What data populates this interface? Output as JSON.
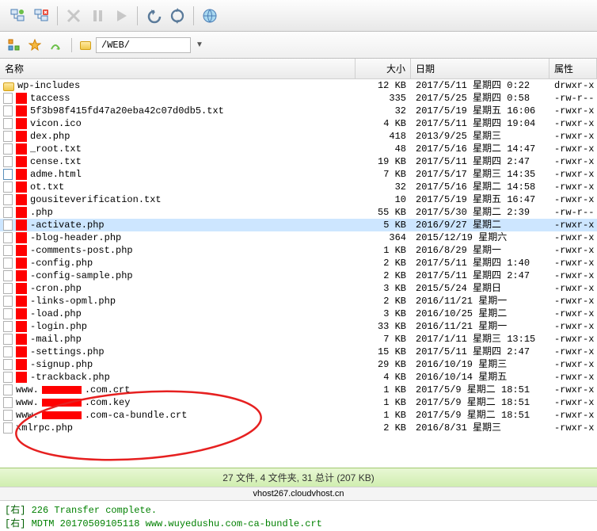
{
  "path": "/WEB/",
  "columns": {
    "name": "名称",
    "size": "大小",
    "date": "日期",
    "attr": "属性"
  },
  "rows": [
    {
      "icon": "folder",
      "name": "wp-includes",
      "size": "12 KB",
      "date": "2017/5/11 星期四 0:22",
      "attr": "drwxr-x"
    },
    {
      "icon": "file",
      "redact": true,
      "name": "taccess",
      "size": "335",
      "date": "2017/5/25 星期四 0:58",
      "attr": "-rw-r--"
    },
    {
      "icon": "file",
      "redact": true,
      "name": "5f3b98f415fd47a20eba42c07d0db5.txt",
      "size": "32",
      "date": "2017/5/19 星期五 16:06",
      "attr": "-rwxr-x"
    },
    {
      "icon": "file",
      "redact": true,
      "name": "vicon.ico",
      "size": "4 KB",
      "date": "2017/5/11 星期四 19:04",
      "attr": "-rwxr-x"
    },
    {
      "icon": "file",
      "redact": true,
      "name": "dex.php",
      "size": "418",
      "date": "2013/9/25 星期三",
      "attr": "-rwxr-x"
    },
    {
      "icon": "file",
      "redact": true,
      "name": "_root.txt",
      "size": "48",
      "date": "2017/5/16 星期二 14:47",
      "attr": "-rwxr-x"
    },
    {
      "icon": "file",
      "redact": true,
      "name": "cense.txt",
      "size": "19 KB",
      "date": "2017/5/11 星期四 2:47",
      "attr": "-rwxr-x"
    },
    {
      "icon": "html",
      "redact": true,
      "name": "adme.html",
      "size": "7 KB",
      "date": "2017/5/17 星期三 14:35",
      "attr": "-rwxr-x"
    },
    {
      "icon": "file",
      "redact": true,
      "name": "ot.txt",
      "size": "32",
      "date": "2017/5/16 星期二 14:58",
      "attr": "-rwxr-x"
    },
    {
      "icon": "file",
      "redact": true,
      "name": "gousiteverification.txt",
      "size": "10",
      "date": "2017/5/19 星期五 16:47",
      "attr": "-rwxr-x"
    },
    {
      "icon": "file",
      "redact": true,
      "name": ".php",
      "size": "55 KB",
      "date": "2017/5/30 星期二 2:39",
      "attr": "-rw-r--"
    },
    {
      "icon": "file",
      "redact": true,
      "name": "-activate.php",
      "sel": true,
      "size": "5 KB",
      "date": "2016/9/27 星期二",
      "attr": "-rwxr-x"
    },
    {
      "icon": "file",
      "redact": true,
      "name": "-blog-header.php",
      "size": "364",
      "date": "2015/12/19 星期六",
      "attr": "-rwxr-x"
    },
    {
      "icon": "file",
      "redact": true,
      "name": "-comments-post.php",
      "size": "1 KB",
      "date": "2016/8/29 星期一",
      "attr": "-rwxr-x"
    },
    {
      "icon": "file",
      "redact": true,
      "name": "-config.php",
      "size": "2 KB",
      "date": "2017/5/11 星期四 1:40",
      "attr": "-rwxr-x"
    },
    {
      "icon": "file",
      "redact": true,
      "name": "-config-sample.php",
      "size": "2 KB",
      "date": "2017/5/11 星期四 2:47",
      "attr": "-rwxr-x"
    },
    {
      "icon": "file",
      "redact": true,
      "name": "-cron.php",
      "size": "3 KB",
      "date": "2015/5/24 星期日",
      "attr": "-rwxr-x"
    },
    {
      "icon": "file",
      "redact": true,
      "name": "-links-opml.php",
      "size": "2 KB",
      "date": "2016/11/21 星期一",
      "attr": "-rwxr-x"
    },
    {
      "icon": "file",
      "redact": true,
      "name": "-load.php",
      "size": "3 KB",
      "date": "2016/10/25 星期二",
      "attr": "-rwxr-x"
    },
    {
      "icon": "file",
      "redact": true,
      "name": "-login.php",
      "size": "33 KB",
      "date": "2016/11/21 星期一",
      "attr": "-rwxr-x"
    },
    {
      "icon": "file",
      "redact": true,
      "name": "-mail.php",
      "size": "7 KB",
      "date": "2017/1/11 星期三 13:15",
      "attr": "-rwxr-x"
    },
    {
      "icon": "file",
      "redact": true,
      "name": "-settings.php",
      "size": "15 KB",
      "date": "2017/5/11 星期四 2:47",
      "attr": "-rwxr-x"
    },
    {
      "icon": "file",
      "redact": true,
      "name": "-signup.php",
      "size": "29 KB",
      "date": "2016/10/19 星期三",
      "attr": "-rwxr-x"
    },
    {
      "icon": "file",
      "redact": true,
      "name": "-trackback.php",
      "size": "4 KB",
      "date": "2016/10/14 星期五",
      "attr": "-rwxr-x"
    },
    {
      "icon": "file",
      "name": "www.",
      "redact_mid": true,
      "suffix": ".com.crt",
      "size": "1 KB",
      "date": "2017/5/9 星期二 18:51",
      "attr": "-rwxr-x"
    },
    {
      "icon": "file",
      "name": "www.",
      "redact_mid": true,
      "suffix": ".com.key",
      "size": "1 KB",
      "date": "2017/5/9 星期二 18:51",
      "attr": "-rwxr-x"
    },
    {
      "icon": "file",
      "name": "www.",
      "redact_mid": true,
      "suffix": ".com-ca-bundle.crt",
      "size": "1 KB",
      "date": "2017/5/9 星期二 18:51",
      "attr": "-rwxr-x"
    },
    {
      "icon": "file",
      "name": "xmlrpc.php",
      "size": "2 KB",
      "date": "2016/8/31 星期三",
      "attr": "-rwxr-x"
    }
  ],
  "status": "27 文件, 4 文件夹, 31 总计 (207 KB)",
  "host": "vhost267.cloudvhost.cn",
  "log": [
    {
      "tag": "[右]",
      "text": " 226 Transfer complete."
    },
    {
      "tag": "[右]",
      "text": " MDTM 20170509105118 www.wuyedushu.com-ca-bundle.crt"
    }
  ]
}
